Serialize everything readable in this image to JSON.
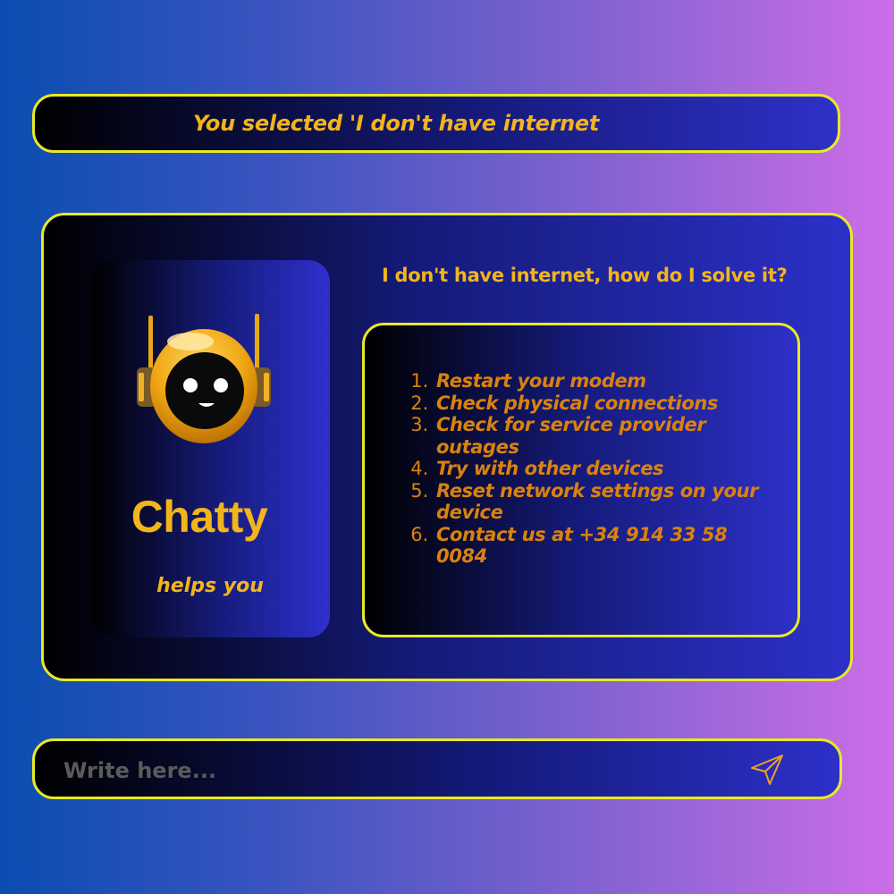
{
  "banner": {
    "text": "You selected 'I don't have internet"
  },
  "bot": {
    "name": "Chatty",
    "tagline": "helps you",
    "avatar_icon": "robot-icon"
  },
  "chat": {
    "question": "I don't have internet, how do I solve it?",
    "steps": [
      "Restart your modem",
      "Check physical connections",
      "Check for service provider outages",
      "Try with other devices",
      "Reset network settings on your device",
      "Contact us at +34 914 33 58 0084"
    ]
  },
  "input": {
    "placeholder": "Write here...",
    "send_icon": "send-icon"
  },
  "colors": {
    "accent_yellow": "#e8ea24",
    "text_gold": "#f2b51b",
    "step_orange": "#d9820f"
  }
}
